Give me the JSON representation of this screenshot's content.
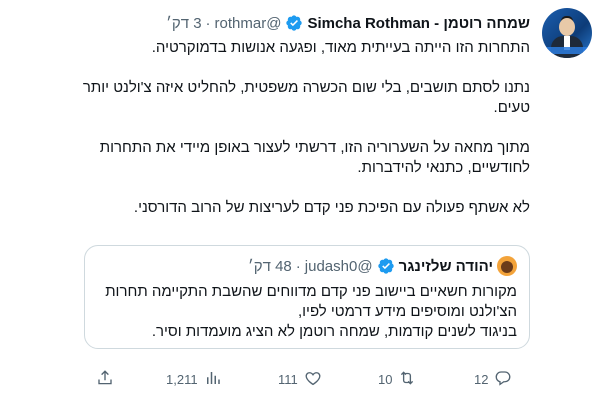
{
  "tweet": {
    "display_name": "שמחה רוטמן - Simcha Rothman",
    "handle": "@rothmar",
    "separator": "·",
    "time": "3 דק׳",
    "paragraphs": [
      "התחרות הזו הייתה בעייתית מאוד, ופגעה אנושות בדמוקרטיה.",
      "נתנו לסתם תושבים, בלי שום הכשרה משפטית, להחליט איזה צ'ולנט יותר טעים.",
      "מתוך מחאה על השערוריה הזו, דרשתי לעצור באופן מיידי את התחרות לחודשיים, כתנאי להידברות.",
      "לא אשתף פעולה עם הפיכת פני קדם לעריצות של הרוב הדורסני."
    ]
  },
  "quote": {
    "display_name": "יהודה שלזינגר",
    "handle": "@judash0",
    "separator": "·",
    "time": "48 דק׳",
    "lines": [
      "מקורות חשאיים ביישוב פני קדם מדווחים שהשבת התקיימה תחרות",
      "הצ'ולנט ומוסיפים מידע דרמטי לפיו,",
      "בניגוד לשנים קודמות, שמחה רוטמן לא הציג מועמדות וסיר."
    ]
  },
  "actions": {
    "reply_count": "12",
    "retweet_count": "10",
    "like_count": "111",
    "views_count": "1,211"
  },
  "icons": {
    "verified": "verified-badge-icon",
    "reply": "reply-icon",
    "retweet": "retweet-icon",
    "like": "heart-icon",
    "views": "views-chart-icon",
    "share": "share-icon"
  },
  "colors": {
    "verified": "#1d9bf0",
    "muted": "#536471",
    "text": "#0f1419",
    "border": "#cfd9de"
  }
}
